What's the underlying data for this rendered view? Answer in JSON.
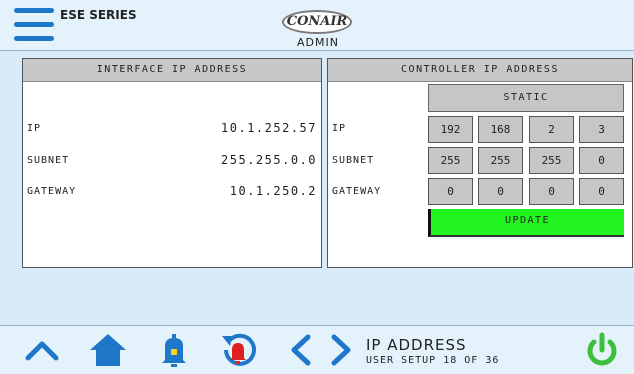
{
  "header": {
    "series_label": "ESE SERIES",
    "logo_text": "CONAIR",
    "user_role": "ADMIN"
  },
  "interface_panel": {
    "title": "INTERFACE IP ADDRESS",
    "rows": [
      {
        "label": "IP",
        "value": "10.1.252.57"
      },
      {
        "label": "SUBNET",
        "value": "255.255.0.0"
      },
      {
        "label": "GATEWAY",
        "value": "10.1.250.2"
      }
    ]
  },
  "controller_panel": {
    "title": "CONTROLLER IP ADDRESS",
    "mode_button": "STATIC",
    "rows": [
      {
        "label": "IP",
        "octets": [
          "192",
          "168",
          "2",
          "3"
        ]
      },
      {
        "label": "SUBNET",
        "octets": [
          "255",
          "255",
          "255",
          "0"
        ]
      },
      {
        "label": "GATEWAY",
        "octets": [
          "0",
          "0",
          "0",
          "0"
        ]
      }
    ],
    "update_button": "UPDATE"
  },
  "footer": {
    "page_title": "IP ADDRESS",
    "page_subtitle": "USER SETUP 18 OF 36",
    "icons": [
      "up-icon",
      "home-icon",
      "bell-icon",
      "alarm-history-icon",
      "previous-icon",
      "next-icon",
      "power-icon"
    ]
  },
  "colors": {
    "accent_blue": "#1f77c9",
    "update_green": "#22f41f",
    "alarm_red": "#e02020",
    "power_green": "#3cc03c"
  }
}
